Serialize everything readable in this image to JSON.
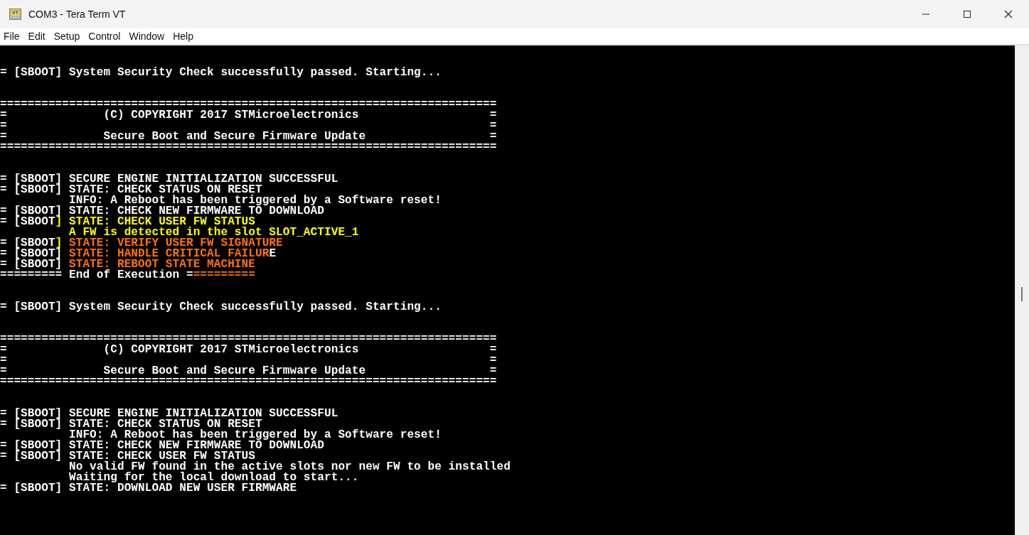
{
  "window": {
    "title": "COM3 - Tera Term VT",
    "app_icon_text": "VT"
  },
  "menu": [
    {
      "label": "File"
    },
    {
      "label": "Edit"
    },
    {
      "label": "Setup"
    },
    {
      "label": "Control"
    },
    {
      "label": "Window"
    },
    {
      "label": "Help"
    }
  ],
  "terminal": {
    "blocks": [
      {
        "lines": [
          {
            "segments": [
              {
                "text": "= [SBOOT] System Security Check successfully passed. Starting...",
                "color": "#ffffff"
              }
            ]
          }
        ]
      },
      {
        "lines": [
          {
            "segments": [
              {
                "text": "========================================================================",
                "color": "#ffffff"
              }
            ]
          },
          {
            "segments": [
              {
                "text": "=              (C) COPYRIGHT 2017 STMicroelectronics                   =",
                "color": "#ffffff"
              }
            ]
          },
          {
            "segments": [
              {
                "text": "=                                                                      =",
                "color": "#ffffff"
              }
            ]
          },
          {
            "segments": [
              {
                "text": "=              Secure Boot and Secure Firmware Update                  =",
                "color": "#ffffff"
              }
            ]
          },
          {
            "segments": [
              {
                "text": "========================================================================",
                "color": "#ffffff"
              }
            ]
          }
        ]
      },
      {
        "lines": [
          {
            "segments": [
              {
                "text": "= [SBOOT] SECURE ENGINE INITIALIZATION SUCCESSFUL",
                "color": "#ffffff"
              }
            ]
          },
          {
            "segments": [
              {
                "text": "= [SBOOT] STATE: CHECK STATUS ON RESET",
                "color": "#ffffff"
              }
            ]
          },
          {
            "segments": [
              {
                "text": "          INFO: A Reboot has been triggered by a Software reset!",
                "color": "#ffffff"
              }
            ]
          },
          {
            "segments": [
              {
                "text": "= [SBOOT] STATE: CHECK NEW FIRMWARE TO DOWNLOAD",
                "color": "#ffffff"
              }
            ]
          },
          {
            "segments": [
              {
                "text": "= [SBOOT",
                "color": "#ffffff"
              },
              {
                "text": "] STATE: CHECK USER FW STATUS",
                "color": "#ffff00"
              }
            ]
          },
          {
            "segments": [
              {
                "text": "          A FW is detected in the slot SLOT_ACTIVE_1",
                "color": "#ffff00"
              }
            ]
          },
          {
            "segments": [
              {
                "text": "= [SBOOT",
                "color": "#ffffff"
              },
              {
                "text": "]",
                "color": "#ffff00"
              },
              {
                "text": " STATE: VERIFY USER FW SIGNATURE",
                "color": "#ff7400"
              }
            ]
          },
          {
            "segments": [
              {
                "text": "= [SBOOT] ",
                "color": "#ffffff"
              },
              {
                "text": "STATE: HANDLE CRITICAL FAILUR",
                "color": "#ff7400"
              },
              {
                "text": "E",
                "color": "#ffffff"
              }
            ]
          },
          {
            "segments": [
              {
                "text": "= [SBOOT] ",
                "color": "#ffffff"
              },
              {
                "text": "STATE: REBOOT STATE MACHINE",
                "color": "#ff7400"
              }
            ]
          },
          {
            "segments": [
              {
                "text": "========= End of Execution =",
                "color": "#ffffff"
              },
              {
                "text": "=========",
                "color": "#ff7400"
              }
            ]
          }
        ]
      },
      {
        "lines": [
          {
            "segments": [
              {
                "text": "= [SBOOT] System Security Check successfully passed. Starting...",
                "color": "#ffffff"
              }
            ]
          }
        ]
      },
      {
        "lines": [
          {
            "segments": [
              {
                "text": "========================================================================",
                "color": "#ffffff"
              }
            ]
          },
          {
            "segments": [
              {
                "text": "=              (C) COPYRIGHT 2017 STMicroelectronics                   =",
                "color": "#ffffff"
              }
            ]
          },
          {
            "segments": [
              {
                "text": "=                                                                      =",
                "color": "#ffffff"
              }
            ]
          },
          {
            "segments": [
              {
                "text": "=              Secure Boot and Secure Firmware Update                  =",
                "color": "#ffffff"
              }
            ]
          },
          {
            "segments": [
              {
                "text": "========================================================================",
                "color": "#ffffff"
              }
            ]
          }
        ]
      },
      {
        "lines": [
          {
            "segments": [
              {
                "text": "= [SBOOT] SECURE ENGINE INITIALIZATION SUCCESSFUL",
                "color": "#ffffff"
              }
            ]
          },
          {
            "segments": [
              {
                "text": "= [SBOOT] STATE: CHECK STATUS ON RESET",
                "color": "#ffffff"
              }
            ]
          },
          {
            "segments": [
              {
                "text": "          INFO: A Reboot has been triggered by a Software reset!",
                "color": "#ffffff"
              }
            ]
          },
          {
            "segments": [
              {
                "text": "= [SBOOT] STATE: CHECK NEW FIRMWARE TO DOWNLOAD",
                "color": "#ffffff"
              }
            ]
          },
          {
            "segments": [
              {
                "text": "= [SBOOT] STATE: CHECK USER FW STATUS",
                "color": "#ffffff"
              }
            ]
          },
          {
            "segments": [
              {
                "text": "          No valid FW found in the active slots nor new FW to be installed",
                "color": "#ffffff"
              }
            ]
          },
          {
            "segments": [
              {
                "text": "          Waiting for the local download to start...",
                "color": "#ffffff"
              }
            ]
          },
          {
            "segments": [
              {
                "text": "= [SBOOT] STATE: DOWNLOAD NEW USER FIRMWARE",
                "color": "#ffffff"
              }
            ]
          }
        ]
      }
    ]
  }
}
